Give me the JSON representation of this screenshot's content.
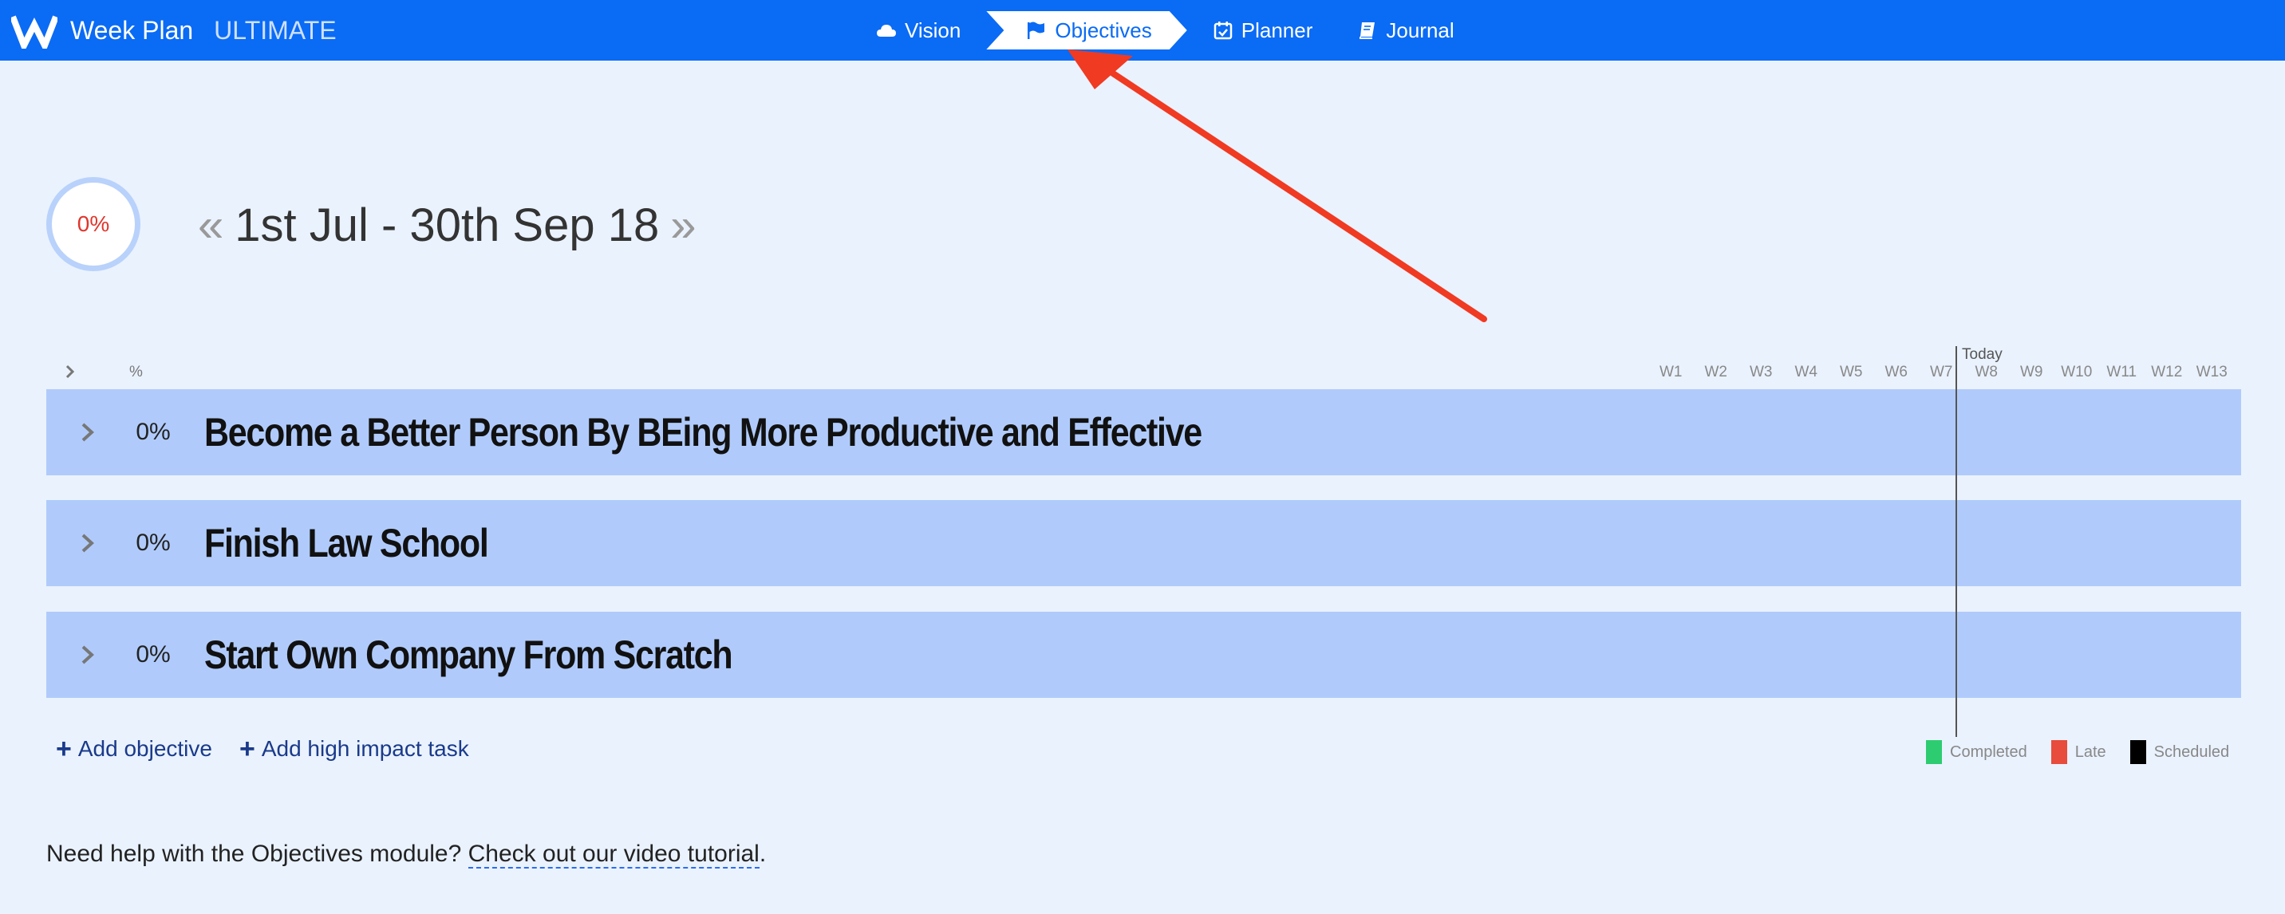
{
  "app": {
    "name": "Week Plan",
    "edition": "ULTIMATE"
  },
  "nav": {
    "items": [
      {
        "label": "Vision",
        "icon": "cloud-icon",
        "active": false
      },
      {
        "label": "Objectives",
        "icon": "flag-icon",
        "active": true
      },
      {
        "label": "Planner",
        "icon": "calendar-check-icon",
        "active": false
      },
      {
        "label": "Journal",
        "icon": "book-icon",
        "active": false
      }
    ]
  },
  "header": {
    "progress": "0%",
    "period": "1st Jul - 30th Sep 18",
    "prev_symbol": "«",
    "next_symbol": "»"
  },
  "timeline": {
    "pct_header": "%",
    "today_label": "Today",
    "weeks": [
      "W1",
      "W2",
      "W3",
      "W4",
      "W5",
      "W6",
      "W7",
      "W8",
      "W9",
      "W10",
      "W11",
      "W12",
      "W13"
    ]
  },
  "objectives": [
    {
      "progress": "0%",
      "title": "Become a Better Person By BEing More Productive and Effective"
    },
    {
      "progress": "0%",
      "title": "Finish Law School"
    },
    {
      "progress": "0%",
      "title": "Start Own Company From Scratch"
    }
  ],
  "actions": {
    "add_objective": "Add objective",
    "add_task": "Add high impact task"
  },
  "legend": [
    {
      "label": "Completed",
      "color": "#2ecc71"
    },
    {
      "label": "Late",
      "color": "#e74c3c"
    },
    {
      "label": "Scheduled",
      "color": "#000000"
    }
  ],
  "help": {
    "prefix": "Need help with the Objectives module? ",
    "link": "Check out our video tutorial",
    "suffix": "."
  },
  "colors": {
    "topbar": "#0a6bf5",
    "page_bg": "#eaf2fe",
    "row_bg": "#b0cbfb",
    "arrow": "#f03a22"
  }
}
